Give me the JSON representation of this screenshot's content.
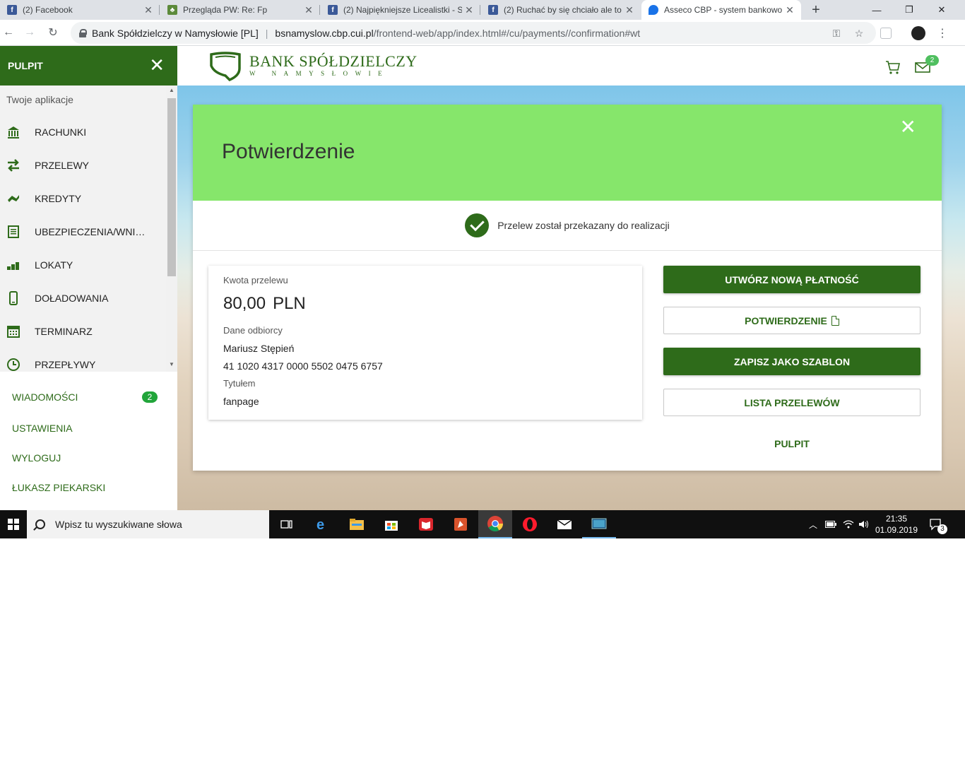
{
  "browser": {
    "tabs": [
      {
        "title": "(2) Facebook",
        "icon": "facebook-icon"
      },
      {
        "title": "Przegląda PW: Re: Fp",
        "icon": "forum-icon"
      },
      {
        "title": "(2) Najpiękniejsze Licealistki - S",
        "icon": "facebook-icon"
      },
      {
        "title": "(2) Ruchać by się chciało ale to",
        "icon": "facebook-icon"
      },
      {
        "title": "Asseco CBP - system bankowo",
        "icon": "map-pin-icon"
      }
    ],
    "address": {
      "site_name": "Bank Spółdzielczy w Namysłowie [PL]",
      "host": "bsnamyslow.cbp.cui.pl",
      "path": "/frontend-web/app/index.html#/cu/payments//confirmation#wt"
    }
  },
  "sidebar": {
    "title": "PULPIT",
    "apps_label": "Twoje aplikacje",
    "items": [
      {
        "label": "RACHUNKI",
        "icon": "bank-icon"
      },
      {
        "label": "PRZELEWY",
        "icon": "transfer-arrows-icon"
      },
      {
        "label": "KREDYTY",
        "icon": "money-hand-icon"
      },
      {
        "label": "UBEZPIECZENIA/WNIOSKI",
        "icon": "document-list-icon"
      },
      {
        "label": "LOKATY",
        "icon": "coins-icon"
      },
      {
        "label": "DOŁADOWANIA",
        "icon": "phone-icon"
      },
      {
        "label": "TERMINARZ",
        "icon": "calendar-icon"
      },
      {
        "label": "PRZEPŁYWY",
        "icon": "clock-icon"
      }
    ],
    "links": {
      "messages": "WIADOMOŚCI",
      "messages_count": "2",
      "settings": "USTAWIENIA",
      "logout": "WYLOGUJ",
      "user": "ŁUKASZ PIEKARSKI"
    }
  },
  "header": {
    "bank_name": "BANK SPÓŁDZIELCZY",
    "bank_city": "W NAMYSŁOWIE",
    "mail_count": "2"
  },
  "confirmation": {
    "title": "Potwierdzenie",
    "status": "Przelew został przekazany do realizacji",
    "amount_label": "Kwota przelewu",
    "amount": "80,00",
    "currency": "PLN",
    "recipient_label": "Dane odbiorcy",
    "recipient_name": "Mariusz Stępień",
    "recipient_account": "41 1020 4317 0000 5502 0475 6757",
    "title_label": "Tytułem",
    "transfer_title": "fanpage"
  },
  "actions": {
    "new_payment": "UTWÓRZ NOWĄ PŁATNOŚĆ",
    "confirmation": "POTWIERDZENIE",
    "save_template": "ZAPISZ JAKO SZABLON",
    "transfers_list": "LISTA PRZELEWÓW",
    "dashboard": "PULPIT"
  },
  "taskbar": {
    "search_placeholder": "Wpisz tu wyszukiwane słowa",
    "time": "21:35",
    "date": "01.09.2019",
    "notifications": "3"
  },
  "colors": {
    "brand_green": "#2e6b1a",
    "header_green": "#86e66b",
    "badge_green": "#21a53a"
  }
}
